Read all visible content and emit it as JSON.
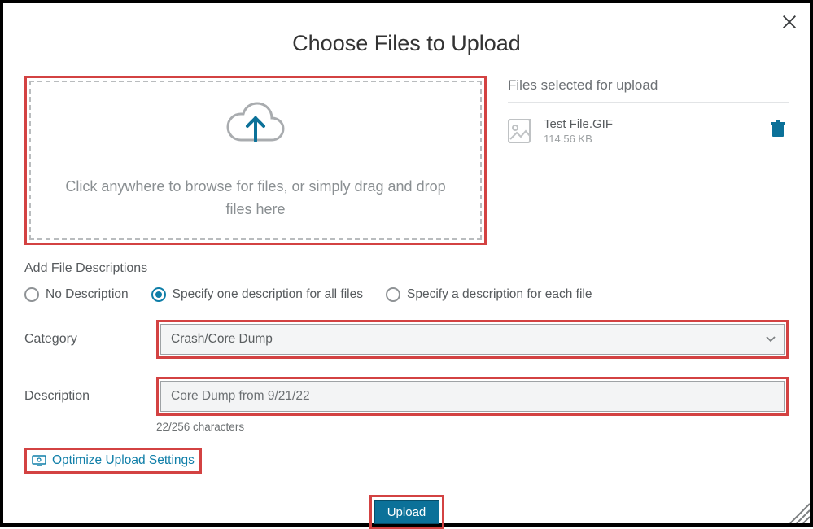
{
  "title": "Choose Files to Upload",
  "dropzone": {
    "text": "Click anywhere to browse for files, or simply drag and drop files here"
  },
  "files": {
    "heading": "Files selected for upload",
    "items": [
      {
        "name": "Test File.GIF",
        "size": "114.56 KB"
      }
    ]
  },
  "descSection": {
    "title": "Add File Descriptions",
    "options": {
      "none": "No Description",
      "one": "Specify one description for all files",
      "each": "Specify a description for each file"
    },
    "selected": "one"
  },
  "category": {
    "label": "Category",
    "value": "Crash/Core Dump"
  },
  "description": {
    "label": "Description",
    "value": "Core Dump from 9/21/22",
    "counter": "22/256 characters"
  },
  "optimize": {
    "label": "Optimize Upload Settings"
  },
  "upload": {
    "label": "Upload"
  }
}
